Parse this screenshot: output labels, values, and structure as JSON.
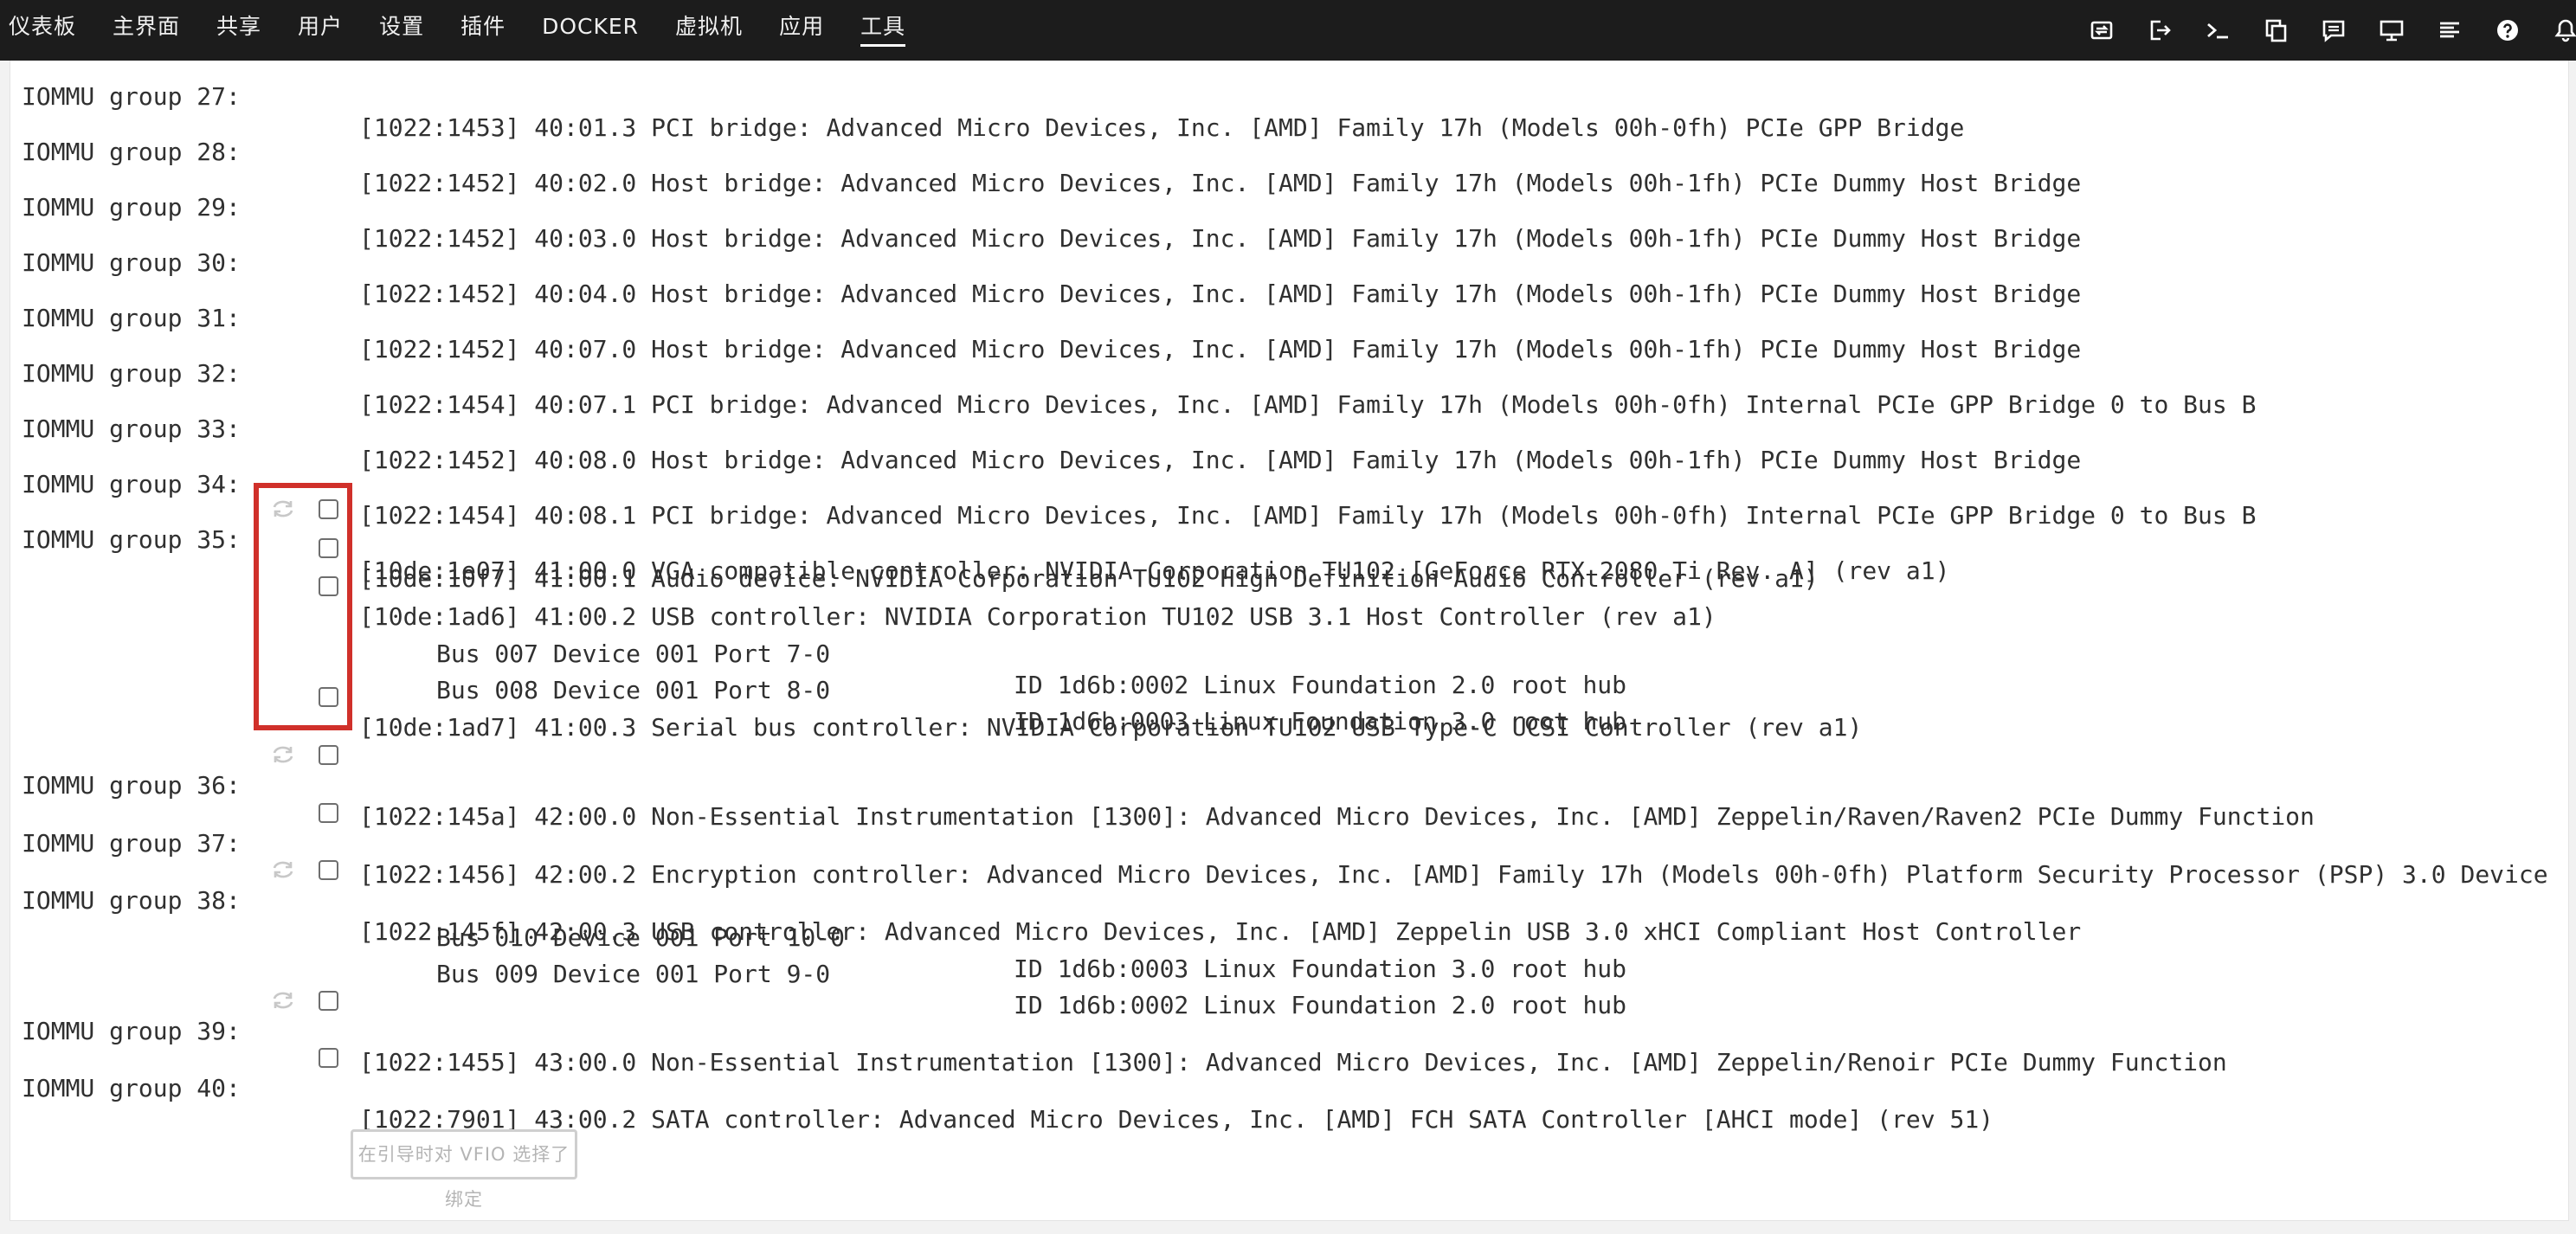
{
  "nav": {
    "items": [
      "仪表板",
      "主界面",
      "共享",
      "用户",
      "设置",
      "插件",
      "DOCKER",
      "虚拟机",
      "应用",
      "工具"
    ],
    "active_index": 9
  },
  "toolbar_icons": [
    "switch-icon",
    "logout-icon",
    "terminal-icon",
    "copy-icon",
    "feedback-icon",
    "monitor-icon",
    "log-icon",
    "help-icon",
    "bell-icon"
  ],
  "accent_color": "#d0302a",
  "iommu": [
    {
      "group": "IOMMU group 27:",
      "devices": [
        {
          "text": "[1022:1453] 40:01.3 PCI bridge: Advanced Micro Devices, Inc. [AMD] Family 17h (Models 00h-0fh) PCIe GPP Bridge"
        }
      ]
    },
    {
      "group": "IOMMU group 28:",
      "devices": [
        {
          "text": "[1022:1452] 40:02.0 Host bridge: Advanced Micro Devices, Inc. [AMD] Family 17h (Models 00h-1fh) PCIe Dummy Host Bridge"
        }
      ]
    },
    {
      "group": "IOMMU group 29:",
      "devices": [
        {
          "text": "[1022:1452] 40:03.0 Host bridge: Advanced Micro Devices, Inc. [AMD] Family 17h (Models 00h-1fh) PCIe Dummy Host Bridge"
        }
      ]
    },
    {
      "group": "IOMMU group 30:",
      "devices": [
        {
          "text": "[1022:1452] 40:04.0 Host bridge: Advanced Micro Devices, Inc. [AMD] Family 17h (Models 00h-1fh) PCIe Dummy Host Bridge"
        }
      ]
    },
    {
      "group": "IOMMU group 31:",
      "devices": [
        {
          "text": "[1022:1452] 40:07.0 Host bridge: Advanced Micro Devices, Inc. [AMD] Family 17h (Models 00h-1fh) PCIe Dummy Host Bridge"
        }
      ]
    },
    {
      "group": "IOMMU group 32:",
      "devices": [
        {
          "text": "[1022:1454] 40:07.1 PCI bridge: Advanced Micro Devices, Inc. [AMD] Family 17h (Models 00h-0fh) Internal PCIe GPP Bridge 0 to Bus B"
        }
      ]
    },
    {
      "group": "IOMMU group 33:",
      "devices": [
        {
          "text": "[1022:1452] 40:08.0 Host bridge: Advanced Micro Devices, Inc. [AMD] Family 17h (Models 00h-1fh) PCIe Dummy Host Bridge"
        }
      ]
    },
    {
      "group": "IOMMU group 34:",
      "devices": [
        {
          "text": "[1022:1454] 40:08.1 PCI bridge: Advanced Micro Devices, Inc. [AMD] Family 17h (Models 00h-0fh) Internal PCIe GPP Bridge 0 to Bus B"
        }
      ]
    },
    {
      "group": "IOMMU group 35:",
      "devices": [
        {
          "text": "[10de:1e07] 41:00.0 VGA compatible controller: NVIDIA Corporation TU102 [GeForce RTX 2080 Ti Rev. A] (rev a1)"
        },
        {
          "text": "[10de:10f7] 41:00.1 Audio device: NVIDIA Corporation TU102 High Definition Audio Controller (rev a1)"
        },
        {
          "text": "[10de:1ad6] 41:00.2 USB controller: NVIDIA Corporation TU102 USB 3.1 Host Controller (rev a1)"
        },
        {
          "usb_bus": "Bus 007 Device 001 Port 7-0",
          "usb_id": "ID 1d6b:0002 Linux Foundation 2.0 root hub"
        },
        {
          "usb_bus": "Bus 008 Device 001 Port 8-0",
          "usb_id": "ID 1d6b:0003 Linux Foundation 3.0 root hub"
        },
        {
          "text": "[10de:1ad7] 41:00.3 Serial bus controller: NVIDIA Corporation TU102 USB Type-C UCSI Controller (rev a1)"
        }
      ]
    },
    {
      "group": "IOMMU group 36:",
      "devices": [
        {
          "text": "[1022:145a] 42:00.0 Non-Essential Instrumentation [1300]: Advanced Micro Devices, Inc. [AMD] Zeppelin/Raven/Raven2 PCIe Dummy Function"
        }
      ]
    },
    {
      "group": "IOMMU group 37:",
      "devices": [
        {
          "text": "[1022:1456] 42:00.2 Encryption controller: Advanced Micro Devices, Inc. [AMD] Family 17h (Models 00h-0fh) Platform Security Processor (PSP) 3.0 Device"
        }
      ]
    },
    {
      "group": "IOMMU group 38:",
      "devices": [
        {
          "text": "[1022:145f] 42:00.3 USB controller: Advanced Micro Devices, Inc. [AMD] Zeppelin USB 3.0 xHCI Compliant Host Controller"
        },
        {
          "usb_bus": "Bus 010 Device 001 Port 10-0",
          "usb_id": "ID 1d6b:0003 Linux Foundation 3.0 root hub"
        },
        {
          "usb_bus": "Bus 009 Device 001 Port 9-0",
          "usb_id": "ID 1d6b:0002 Linux Foundation 2.0 root hub"
        }
      ]
    },
    {
      "group": "IOMMU group 39:",
      "devices": [
        {
          "text": "[1022:1455] 43:00.0 Non-Essential Instrumentation [1300]: Advanced Micro Devices, Inc. [AMD] Zeppelin/Renoir PCIe Dummy Function"
        }
      ]
    },
    {
      "group": "IOMMU group 40:",
      "devices": [
        {
          "text": "[1022:7901] 43:00.2 SATA controller: Advanced Micro Devices, Inc. [AMD] FCH SATA Controller [AHCI mode] (rev 51)"
        }
      ]
    }
  ],
  "bind_button": {
    "label": "在引导时对 VFIO 选择了绑定"
  }
}
